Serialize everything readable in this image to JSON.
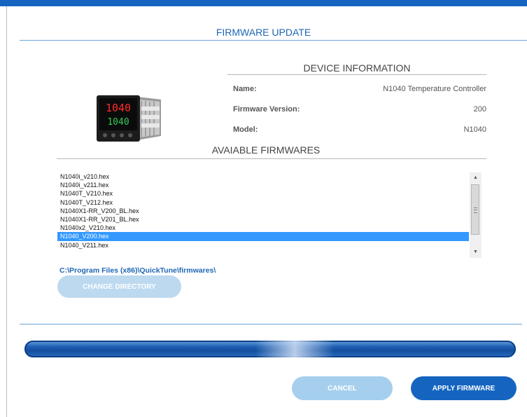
{
  "window": {
    "title": "FIRMWARE UPDATE"
  },
  "device_info": {
    "heading": "DEVICE INFORMATION",
    "fields": [
      {
        "label": "Name:",
        "value": "N1040 Temperature Controller"
      },
      {
        "label": "Firmware Version:",
        "value": "200"
      },
      {
        "label": "Model:",
        "value": "N1040"
      }
    ],
    "display_top": "1040",
    "display_bottom": "1040"
  },
  "firmwares": {
    "heading": "AVAIABLE FIRMWARES",
    "items": [
      "N1040i_v210.hex",
      "N1040i_v211.hex",
      "N1040T_V210.hex",
      "N1040T_V212.hex",
      "N1040X1-RR_V200_BL.hex",
      "N1040X1-RR_V201_BL.hex",
      "N1040x2_V210.hex",
      "N1040_V200.hex",
      "N1040_V211.hex"
    ],
    "selected": "N1040_V200.hex",
    "directory": "C:\\Program Files (x86)\\QuickTune\\firmwares\\"
  },
  "buttons": {
    "change_directory": "CHANGE DIRECTORY",
    "cancel": "CANCEL",
    "apply": "APPLY FIRMWARE"
  },
  "colors": {
    "accent": "#1565c0",
    "disabled": "#bcd9f0",
    "selection": "#3399ff"
  }
}
